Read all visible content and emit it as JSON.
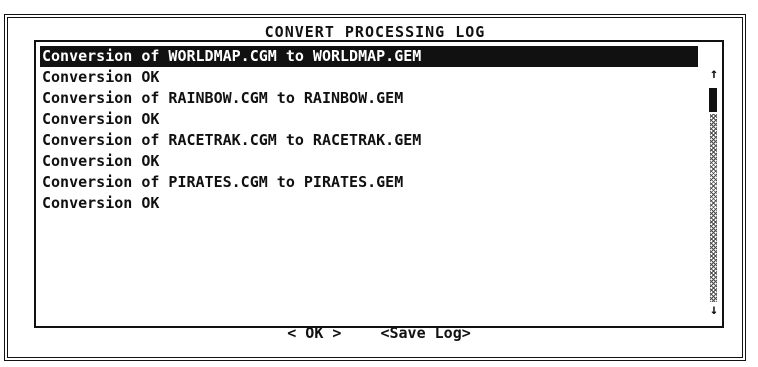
{
  "dialog": {
    "title": "CONVERT PROCESSING LOG"
  },
  "log": {
    "lines": [
      "Conversion of WORLDMAP.CGM to WORLDMAP.GEM",
      "Conversion OK",
      "Conversion of RAINBOW.CGM to RAINBOW.GEM",
      "Conversion OK",
      "Conversion of RACETRAK.CGM to RACETRAK.GEM",
      "Conversion OK",
      "Conversion of PIRATES.CGM to PIRATES.GEM",
      "Conversion OK"
    ],
    "selected_index": 0
  },
  "scrollbar": {
    "up_arrow": "↑",
    "down_arrow": "↓"
  },
  "buttons": {
    "ok": "< OK >",
    "save_log": "<Save Log>"
  }
}
